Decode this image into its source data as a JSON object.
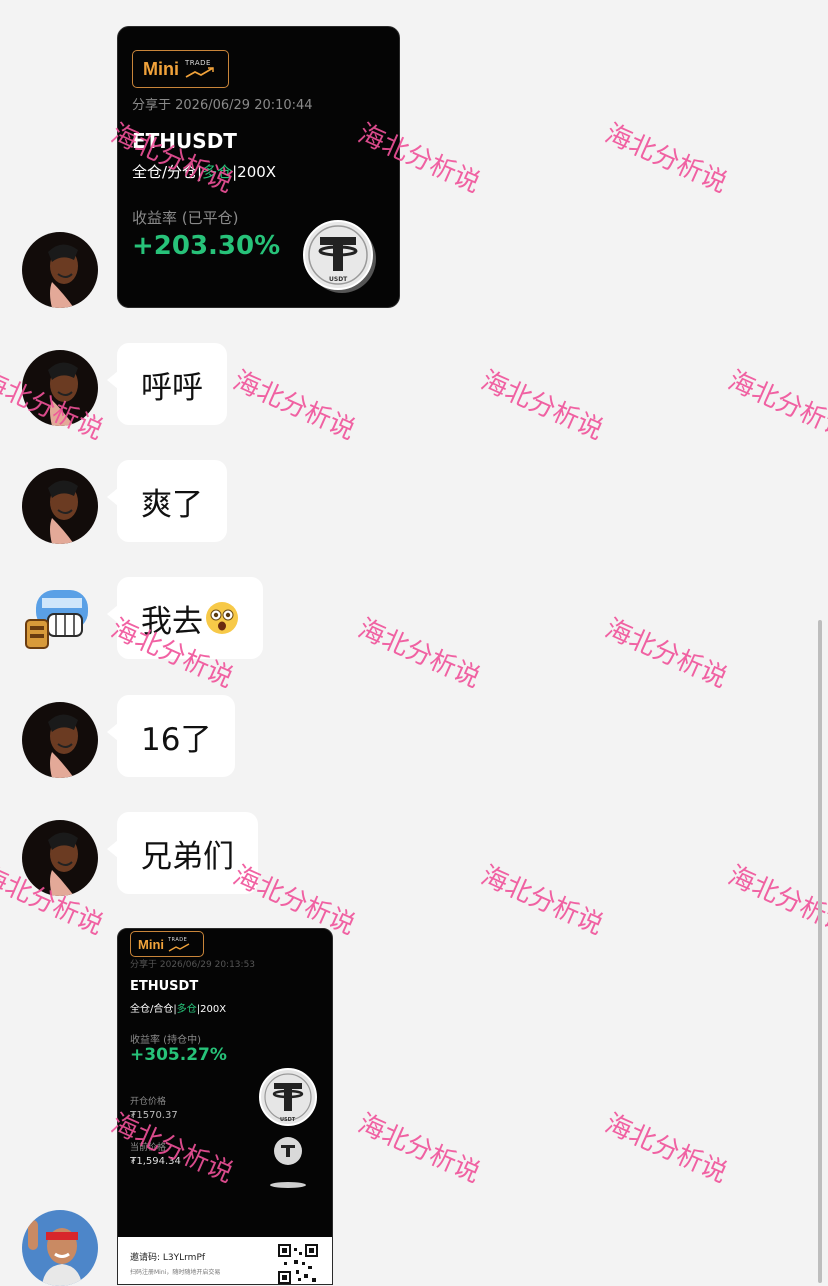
{
  "card1": {
    "logo_text": "Mini",
    "logo_sub": "TRADE",
    "shared_at": "分享于 2026/06/29 20:10:44",
    "symbol": "ETHUSDT",
    "margin_mode": "全仓/分仓|",
    "direction": "多仓",
    "leverage": "|200X",
    "pnl_label": "收益率 (已平仓)",
    "pnl_value": "+203.30%",
    "coin_label": "USDT"
  },
  "messages": [
    {
      "text": "呼呼"
    },
    {
      "text": "爽了"
    },
    {
      "text": "我去"
    },
    {
      "text": "16了"
    },
    {
      "text": "兄弟们"
    }
  ],
  "card2": {
    "logo_text": "Mini",
    "logo_sub": "TRADE",
    "shared_at": "分享于 2026/06/29 20:13:53",
    "symbol": "ETHUSDT",
    "margin_mode": "全仓/合仓|",
    "direction": "多仓",
    "leverage": "|200X",
    "pnl_label": "收益率 (持仓中)",
    "pnl_value": "+305.27%",
    "open_label": "开仓价格",
    "open_value": "₮1570.37",
    "current_label": "当前价格",
    "current_value": "₮1,594.34",
    "invite_label": "邀请码: L3YLrmPf",
    "invite_note": "扫码注册Mini，随时随地开启交易",
    "coin_label": "USDT"
  },
  "watermark_text": "海北分析说",
  "colors": {
    "background": "#f3f3f3",
    "profit_green": "#27c279",
    "watermark_pink": "#f0529a",
    "logo_orange": "#f0a23b"
  }
}
